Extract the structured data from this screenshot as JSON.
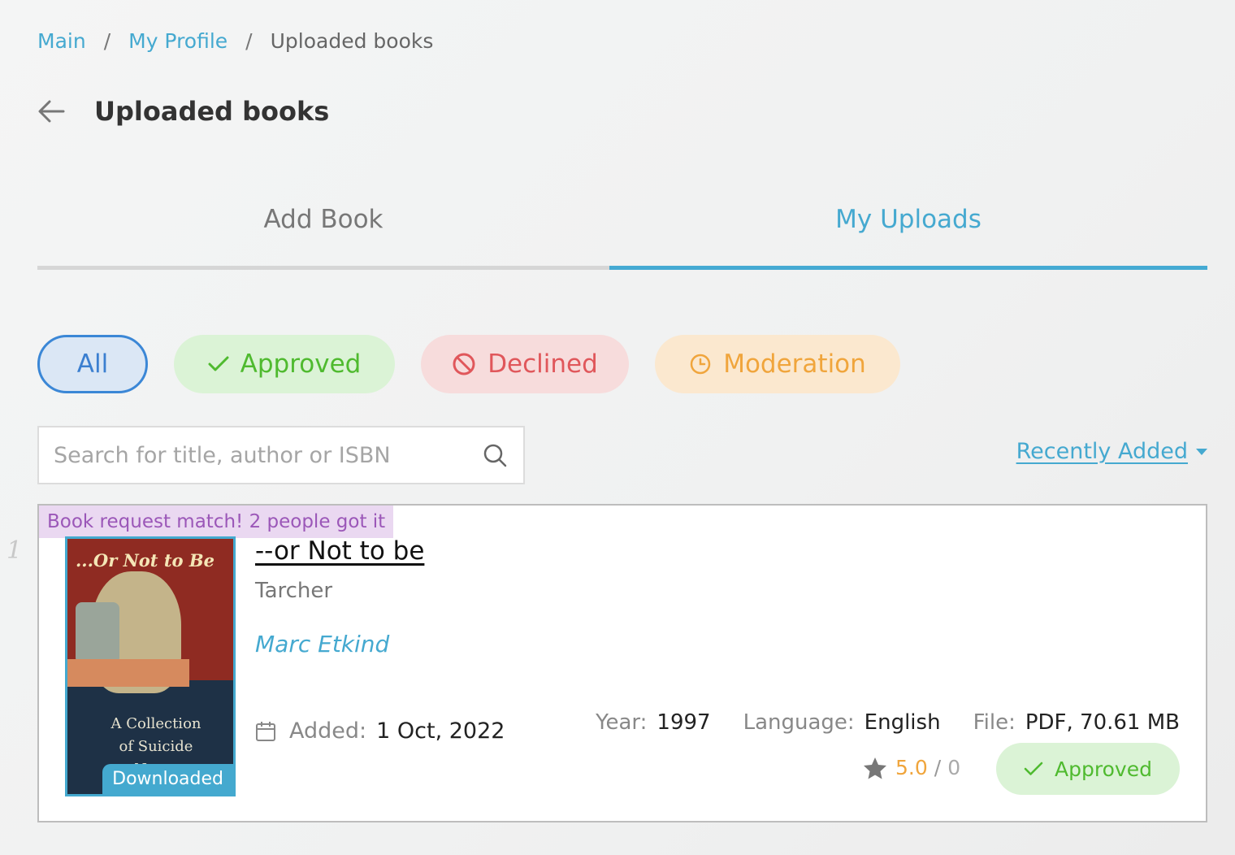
{
  "breadcrumb": {
    "items": [
      "Main",
      "My Profile"
    ],
    "separator": "/",
    "current": "Uploaded books"
  },
  "header": {
    "title": "Uploaded books",
    "back_icon": "arrow-left-icon"
  },
  "tabs": [
    {
      "label": "Add Book",
      "active": false
    },
    {
      "label": "My Uploads",
      "active": true
    }
  ],
  "filters": {
    "all": "All",
    "approved": "Approved",
    "declined": "Declined",
    "moderation": "Moderation"
  },
  "search": {
    "placeholder": "Search for title, author or ISBN",
    "value": ""
  },
  "sort": {
    "label": "Recently Added"
  },
  "books": [
    {
      "index": "1",
      "match_notice": "Book request match! 2 people got it",
      "cover_title": "...Or Not to Be",
      "cover_subtitle": "A Collection of Suicide Notes",
      "cover_badge": "Downloaded",
      "title": "--or Not to be",
      "publisher": "Tarcher",
      "author": "Marc Etkind",
      "added_label": "Added:",
      "added_value": "1 Oct, 2022",
      "year_label": "Year:",
      "year_value": "1997",
      "language_label": "Language:",
      "language_value": "English",
      "file_label": "File:",
      "file_value": "PDF, 70.61 MB",
      "rating": "5.0",
      "rating_separator": "/",
      "rating_count": "0",
      "status": "Approved"
    }
  ],
  "colors": {
    "accent": "#45a9d0",
    "approved": "#4fba2f",
    "declined": "#e0575b",
    "moderation": "#f0a53c",
    "all_chip": "#3b87d6",
    "match": "#9b57b8"
  }
}
